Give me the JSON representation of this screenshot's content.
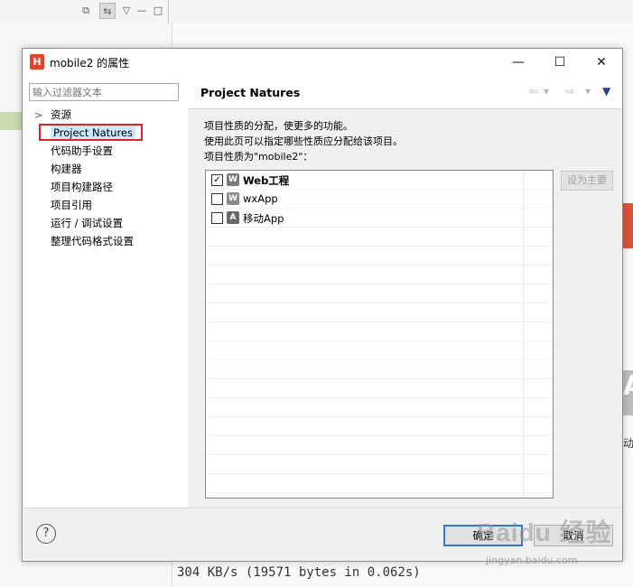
{
  "background": {
    "console_line": "304 KB/s (19571 bytes in 0.062s)",
    "cn_fragment": "动",
    "right_letter": "A"
  },
  "dialog": {
    "title": "mobile2 的属性",
    "app_icon_letter": "H",
    "filter_placeholder": "输入过滤器文本",
    "tree": [
      {
        "label": "资源"
      },
      {
        "label": "Project Natures"
      },
      {
        "label": "代码助手设置"
      },
      {
        "label": "构建器"
      },
      {
        "label": "项目构建路径"
      },
      {
        "label": "项目引用"
      },
      {
        "label": "运行 / 调试设置"
      },
      {
        "label": "整理代码格式设置"
      }
    ],
    "selected_item": "Project Natures",
    "page_title": "Project Natures",
    "description_lines": [
      "项目性质的分配，使更多的功能。",
      "使用此页可以指定哪些性质应分配给该项目。",
      "项目性质为\"mobile2\"："
    ],
    "natures": [
      {
        "label": "Web工程",
        "checked": true,
        "bold": true,
        "icon": "W",
        "icon_color": "#7a7a7a"
      },
      {
        "label": "wxApp",
        "checked": false,
        "bold": false,
        "icon": "W",
        "icon_color": "#8a8a8a"
      },
      {
        "label": "移动App",
        "checked": false,
        "bold": false,
        "icon": "A",
        "icon_color": "#6a6a6a"
      }
    ],
    "set_primary_label": "设为主要",
    "ok_label": "确定",
    "cancel_label": "取消",
    "help_symbol": "?"
  },
  "watermark": {
    "brand": "Baidu 经验",
    "url": "jingyan.baidu.com"
  },
  "colors": {
    "selection_frame": "#d9262c",
    "selection_fill": "#cce8ff",
    "app_icon": "#e0452a",
    "default_button_border": "#3178d6"
  }
}
